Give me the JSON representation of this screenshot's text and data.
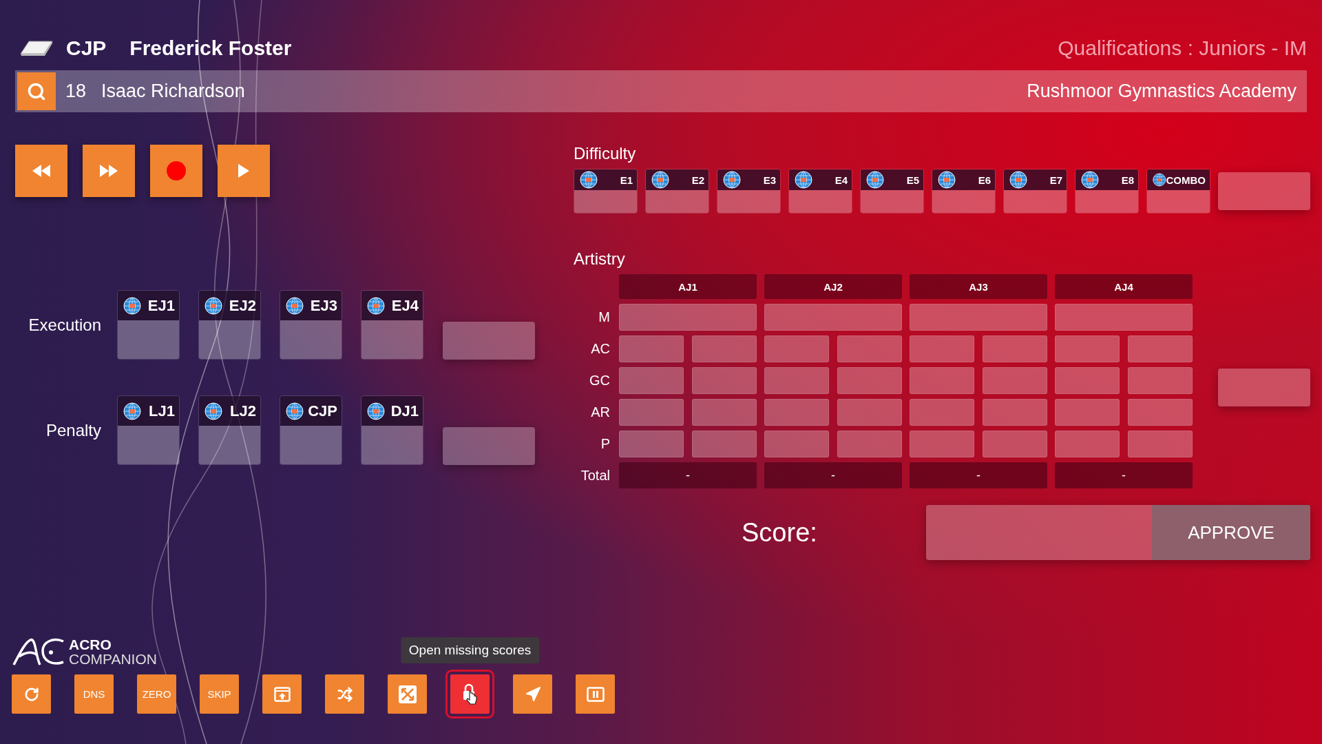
{
  "header": {
    "role": "CJP",
    "judge_name": "Frederick Foster",
    "session": "Qualifications : Juniors - IM"
  },
  "athlete_bar": {
    "number": "18",
    "name": "Isaac Richardson",
    "club": "Rushmoor Gymnastics Academy"
  },
  "transport_buttons": [
    {
      "kind": "rewind"
    },
    {
      "kind": "fast_forward"
    },
    {
      "kind": "record"
    },
    {
      "kind": "play"
    }
  ],
  "execution": {
    "label": "Execution",
    "judges": [
      "EJ1",
      "EJ2",
      "EJ3",
      "EJ4"
    ]
  },
  "penalty": {
    "label": "Penalty",
    "judges": [
      "LJ1",
      "LJ2",
      "CJP",
      "DJ1"
    ]
  },
  "difficulty": {
    "title": "Difficulty",
    "judges": [
      "E1",
      "E2",
      "E3",
      "E4",
      "E5",
      "E6",
      "E7",
      "E8",
      "COMBO"
    ]
  },
  "artistry": {
    "title": "Artistry",
    "judges": [
      "AJ1",
      "AJ2",
      "AJ3",
      "AJ4"
    ],
    "rows": [
      {
        "label": "M",
        "kind": "single"
      },
      {
        "label": "AC",
        "kind": "split"
      },
      {
        "label": "GC",
        "kind": "split"
      },
      {
        "label": "AR",
        "kind": "split"
      },
      {
        "label": "P",
        "kind": "split"
      }
    ],
    "total": {
      "label": "Total",
      "values": [
        "-",
        "-",
        "-",
        "-"
      ]
    }
  },
  "score": {
    "label": "Score:",
    "action": "APPROVE"
  },
  "logo": {
    "line1": "ACRO",
    "line2": "COMPANION"
  },
  "toolbar": {
    "tooltip": "Open missing scores",
    "items": [
      {
        "kind": "refresh",
        "selected": false
      },
      {
        "kind": "text",
        "label": "DNS",
        "selected": false
      },
      {
        "kind": "text",
        "label": "ZERO",
        "selected": false
      },
      {
        "kind": "text",
        "label": "SKIP",
        "selected": false
      },
      {
        "kind": "upload",
        "selected": false
      },
      {
        "kind": "shuffle",
        "selected": false
      },
      {
        "kind": "expand",
        "selected": false
      },
      {
        "kind": "lock",
        "selected": true
      },
      {
        "kind": "send",
        "selected": false
      },
      {
        "kind": "pause",
        "selected": false
      }
    ]
  }
}
